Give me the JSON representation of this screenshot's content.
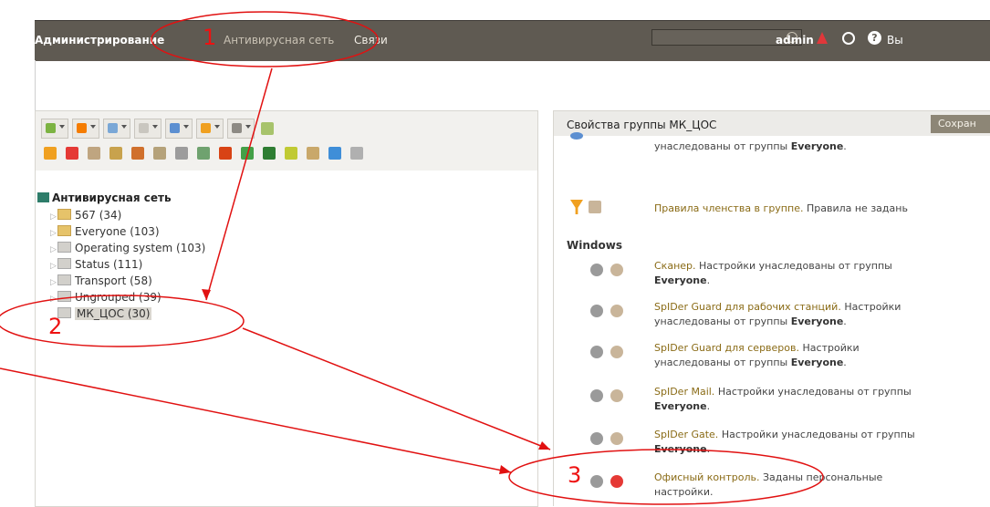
{
  "nav": {
    "items": [
      {
        "label": "Администрирование"
      },
      {
        "label": "Антивирусная сеть"
      },
      {
        "label": "Связи"
      }
    ],
    "user": "admin",
    "exit_label": "Вы"
  },
  "tree": {
    "root": "Антивирусная сеть",
    "items": [
      {
        "label": "567 (34)",
        "folder": "yellow"
      },
      {
        "label": "Everyone (103)",
        "folder": "yellow"
      },
      {
        "label": "Operating system (103)",
        "folder": "gray"
      },
      {
        "label": "Status (111)",
        "folder": "gray"
      },
      {
        "label": "Transport (58)",
        "folder": "gray"
      },
      {
        "label": "Ungrouped (39)",
        "folder": "gray"
      },
      {
        "label": "МК_ЦОС (30)",
        "folder": "gray",
        "selected": true
      }
    ]
  },
  "properties": {
    "title": "Свойства группы МК_ЦОС",
    "save_label": "Сохран",
    "partial_top": "унаследованы от группы",
    "partial_top_bold": "Everyone",
    "membership_link": "Правила членства в группе.",
    "membership_text": "Правила не задань",
    "section": "Windows",
    "items": [
      {
        "link": "Сканер.",
        "text1": "Настройки унаследованы от группы",
        "text2": "",
        "bold": "Everyone",
        "tail": "."
      },
      {
        "link": "SpIDer Guard для рабочих станций.",
        "text1": "Настройки",
        "text2": "унаследованы от группы",
        "bold": "Everyone",
        "tail": "."
      },
      {
        "link": "SpIDer Guard для серверов.",
        "text1": "Настройки",
        "text2": "унаследованы от группы",
        "bold": "Everyone",
        "tail": "."
      },
      {
        "link": "SpIDer Mail.",
        "text1": "Настройки унаследованы от группы",
        "text2": "",
        "bold": "Everyone",
        "tail": "."
      },
      {
        "link": "SpIDer Gate.",
        "text1": "Настройки унаследованы от группы",
        "text2": "",
        "bold": "Everyone",
        "tail": "."
      },
      {
        "link": "Офисный контроль.",
        "text1": "Заданы персональные",
        "text2": "настройки.",
        "bold": "",
        "tail": ""
      }
    ]
  },
  "annotations": {
    "n1": "1",
    "n2": "2",
    "n3": "3",
    "color": "#e11111"
  }
}
